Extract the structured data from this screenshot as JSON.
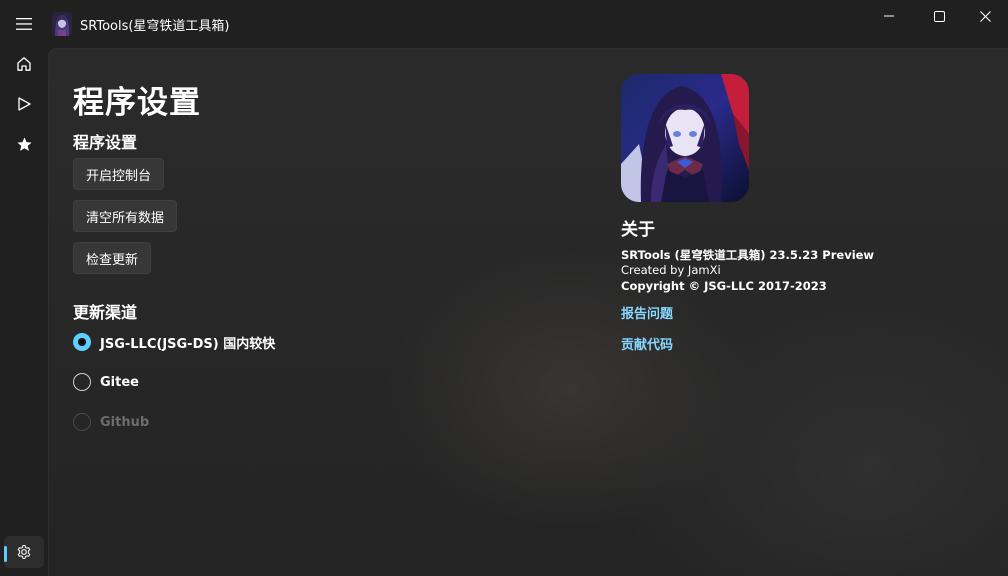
{
  "window": {
    "title": "SRTools(星穹铁道工具箱)"
  },
  "nav": {
    "items": [
      {
        "name": "home",
        "icon": "home-icon"
      },
      {
        "name": "play",
        "icon": "play-icon"
      },
      {
        "name": "favorites",
        "icon": "star-icon"
      }
    ],
    "footer_icon": "gear-icon"
  },
  "page": {
    "title": "程序设置",
    "section_program": "程序设置",
    "buttons": {
      "console": "开启控制台",
      "clear": "清空所有数据",
      "update": "检查更新"
    },
    "section_channel": "更新渠道",
    "channels": [
      {
        "label": "JSG-LLC(JSG-DS) 国内较快",
        "state": "checked"
      },
      {
        "label": "Gitee",
        "state": "unchecked"
      },
      {
        "label": "Github",
        "state": "disabled"
      }
    ]
  },
  "about": {
    "heading": "关于",
    "version": "SRTools (星穹铁道工具箱) 23.5.23 Preview",
    "author": "Created by JamXi",
    "copyright": "Copyright © JSG-LLC 2017-2023",
    "link_issue": "报告问题",
    "link_code": "贡献代码"
  },
  "colors": {
    "accent": "#60cdff",
    "link": "#88d8ff",
    "background": "#202020"
  }
}
